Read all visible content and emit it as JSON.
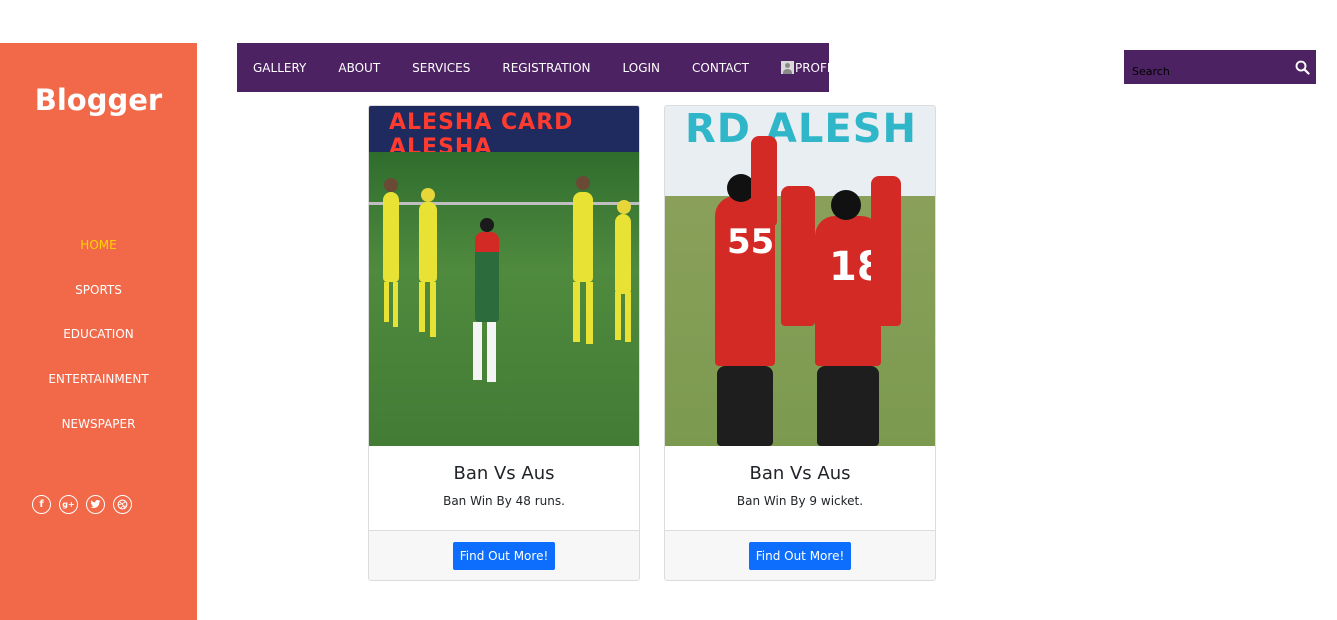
{
  "sidebar": {
    "brand": "Blogger",
    "items": [
      {
        "label": "HOME",
        "active": true
      },
      {
        "label": "SPORTS",
        "active": false
      },
      {
        "label": "EDUCATION",
        "active": false
      },
      {
        "label": "ENTERTAINMENT",
        "active": false
      },
      {
        "label": "NEWSPAPER",
        "active": false
      }
    ],
    "socials": [
      "facebook-icon",
      "google-plus-icon",
      "twitter-icon",
      "dribbble-icon"
    ]
  },
  "topnav": {
    "items": [
      "GALLERY",
      "ABOUT",
      "SERVICES",
      "REGISTRATION",
      "LOGIN",
      "CONTACT",
      "PROFILE"
    ]
  },
  "search": {
    "placeholder": "Search"
  },
  "cards": [
    {
      "title": "Ban Vs Aus",
      "text": "Ban Win By 48 runs.",
      "button": "Find Out More!",
      "banner": "ALESHA CARD ALESHA"
    },
    {
      "title": "Ban Vs Aus",
      "text": "Ban Win By 9 wicket.",
      "button": "Find Out More!",
      "banner": "RD ALESH"
    }
  ],
  "colors": {
    "sidebar": "#f2694a",
    "nav": "#4c2262",
    "active": "#ffd200",
    "button": "#0d6efd"
  }
}
